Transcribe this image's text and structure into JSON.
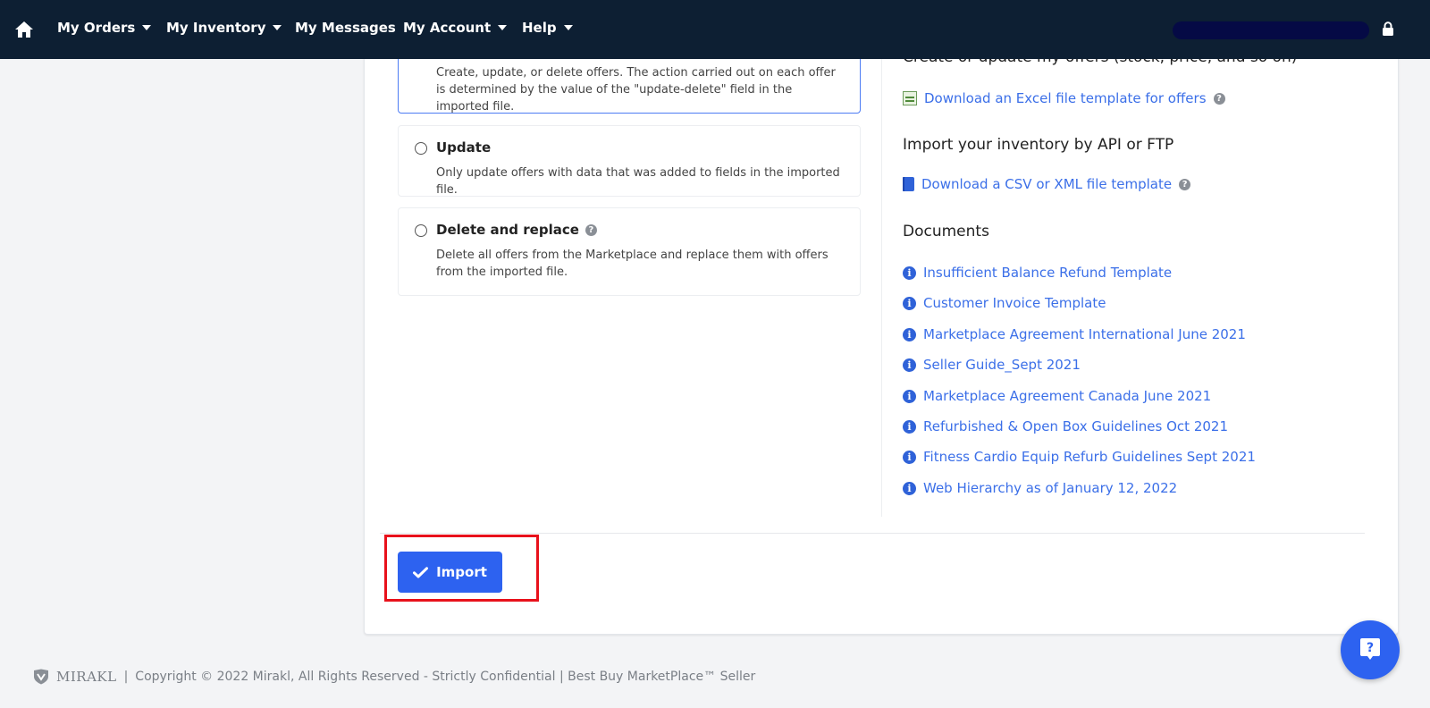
{
  "nav": {
    "items": [
      {
        "label": "My Orders",
        "dropdown": true
      },
      {
        "label": "My Inventory",
        "dropdown": true
      },
      {
        "label": "My Messages",
        "dropdown": false
      },
      {
        "label": "My Account",
        "dropdown": true
      },
      {
        "label": "Help",
        "dropdown": true
      }
    ],
    "icons": [
      "home-icon",
      "lock-icon"
    ]
  },
  "import_options": [
    {
      "title": "",
      "description": "Create, update, or delete offers. The action carried out on each offer is determined by the value of the \"update-delete\" field in the imported file.",
      "selected": true
    },
    {
      "title": "Update",
      "description": "Only update offers with data that was added to fields in the imported file.",
      "selected": false
    },
    {
      "title": "Delete and replace",
      "description": "Delete all offers from the Marketplace and replace them with offers from the imported file.",
      "selected": false,
      "has_help_icon": true
    }
  ],
  "resources": {
    "partial_heading": "Create or update my offers (stock, price, and so on)",
    "excel_link": "Download an Excel file template for offers",
    "api_heading": "Import your inventory by API or FTP",
    "csv_link": "Download a CSV or XML file template",
    "documents_heading": "Documents",
    "documents": [
      "Insufficient Balance Refund Template",
      "Customer Invoice Template",
      "Marketplace Agreement International June 2021",
      "Seller Guide_Sept 2021",
      "Marketplace Agreement Canada June 2021",
      "Refurbished & Open Box Guidelines Oct 2021",
      "Fitness Cardio Equip Refurb Guidelines Sept 2021",
      "Web Hierarchy as of January 12, 2022"
    ]
  },
  "actions": {
    "import_label": "Import"
  },
  "footer": {
    "brand": "MIRAKL",
    "separator": "|",
    "copyright": "Copyright © 2022 Mirakl, All Rights Reserved - Strictly Confidential | Best Buy MarketPlace™ Seller"
  },
  "colors": {
    "nav_bg": "#0d1f33",
    "accent": "#2d62f0",
    "link": "#3b6fe8",
    "highlight": "#e8111b"
  }
}
